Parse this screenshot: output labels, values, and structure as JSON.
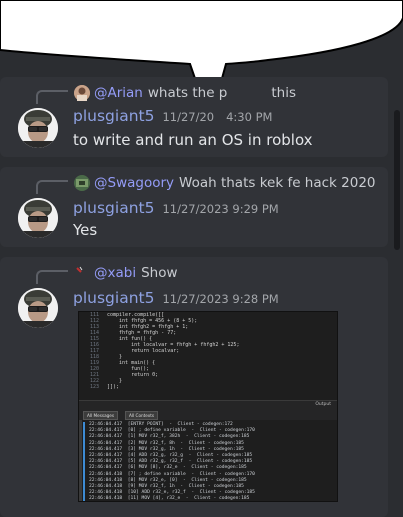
{
  "messages": [
    {
      "reply_user": "@Arian",
      "reply_text": "whats the p",
      "reply_text_tail": "this",
      "author": "plusgiant5",
      "timestamp": "11/27/20",
      "timestamp_tail": "4:30 PM",
      "content": "to write and run an OS in roblox"
    },
    {
      "reply_user": "@Swagoory",
      "reply_text": "Woah thats kek fe hack 2020",
      "author": "plusgiant5",
      "timestamp": "11/27/2023 9:29 PM",
      "content": "Yes"
    },
    {
      "reply_user": "@xabi",
      "reply_text": "Show",
      "author": "plusgiant5",
      "timestamp": "11/27/2023 9:28 PM"
    }
  ],
  "attachment": {
    "code_lines": [
      {
        "n": "111",
        "t": "compiler.compile([["
      },
      {
        "n": "112",
        "t": "    int fhfgh = 456 + (8 + 5);"
      },
      {
        "n": "113",
        "t": "    int fhfgh2 = fhfgh + 1;"
      },
      {
        "n": "114",
        "t": "    fhfgh = fhfgh - 77;"
      },
      {
        "n": "115",
        "t": "    int fun() {"
      },
      {
        "n": "116",
        "t": "        int localvar = fhfgh + fhfgh2 + 125;"
      },
      {
        "n": "117",
        "t": "        return localvar;"
      },
      {
        "n": "118",
        "t": "    }"
      },
      {
        "n": "119",
        "t": "    int main() {"
      },
      {
        "n": "120",
        "t": "        fun();"
      },
      {
        "n": "121",
        "t": "        return 0;"
      },
      {
        "n": "122",
        "t": "    }"
      },
      {
        "n": "123",
        "t": "]]);"
      }
    ],
    "output_label": "Output",
    "filter_messages": "All Messages",
    "filter_contexts": "All Contexts",
    "log_lines": [
      "22:46:04.417  [ENTRY POINT]  -  Client - codegen:172",
      "22:46:04.417  [0] ; define variable  -  Client - codegen:170",
      "22:46:04.417  [1] MOV r32_f, 382h  -  Client - codegen:185",
      "22:46:04.417  [2] MOV r32_f, 8h  -  Client - codegen:185",
      "22:46:04.417  [3] MOV r32_g, 1h  -  Client - codegen:185",
      "22:46:04.417  [4] ADD r32_g, r32_g  -  Client - codegen:185",
      "22:46:04.417  [5] ADD r32_g, r32_f  -  Client - codegen:185",
      "22:46:04.417  [6] MOV [8], r32_e  -  Client - codegen:185",
      "22:46:04.418  [7] ; define variable  -  Client - codegen:170",
      "22:46:04.418  [8] MOV r32_e, [0]  -  Client - codegen:185",
      "22:46:04.418  [9] MOV r32_f, 1h  -  Client - codegen:185",
      "22:46:04.418  [10] ADD r32_e, r32_f  -  Client - codegen:185",
      "22:46:04.418  [11] MOV [4], r32_e  -  Client - codegen:185",
      "22:46:04.418  [12] ; define variable  -  Client - codegen:185"
    ]
  }
}
